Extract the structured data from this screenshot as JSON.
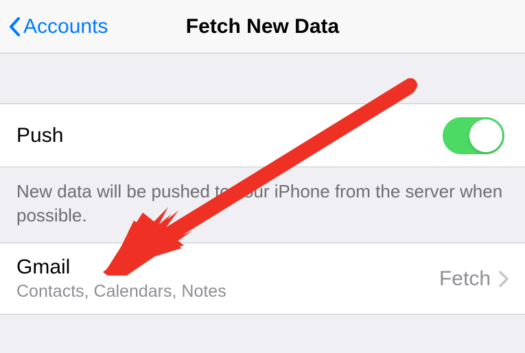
{
  "nav": {
    "back_label": "Accounts",
    "title": "Fetch New Data"
  },
  "push": {
    "label": "Push",
    "on": true,
    "footer": "New data will be pushed to your iPhone from the server when possible."
  },
  "accounts": [
    {
      "name": "Gmail",
      "detail": "Contacts, Calendars, Notes",
      "mode": "Fetch"
    }
  ],
  "colors": {
    "tint": "#007aff",
    "switch_on": "#4cd964",
    "annotation": "#ee3124"
  }
}
